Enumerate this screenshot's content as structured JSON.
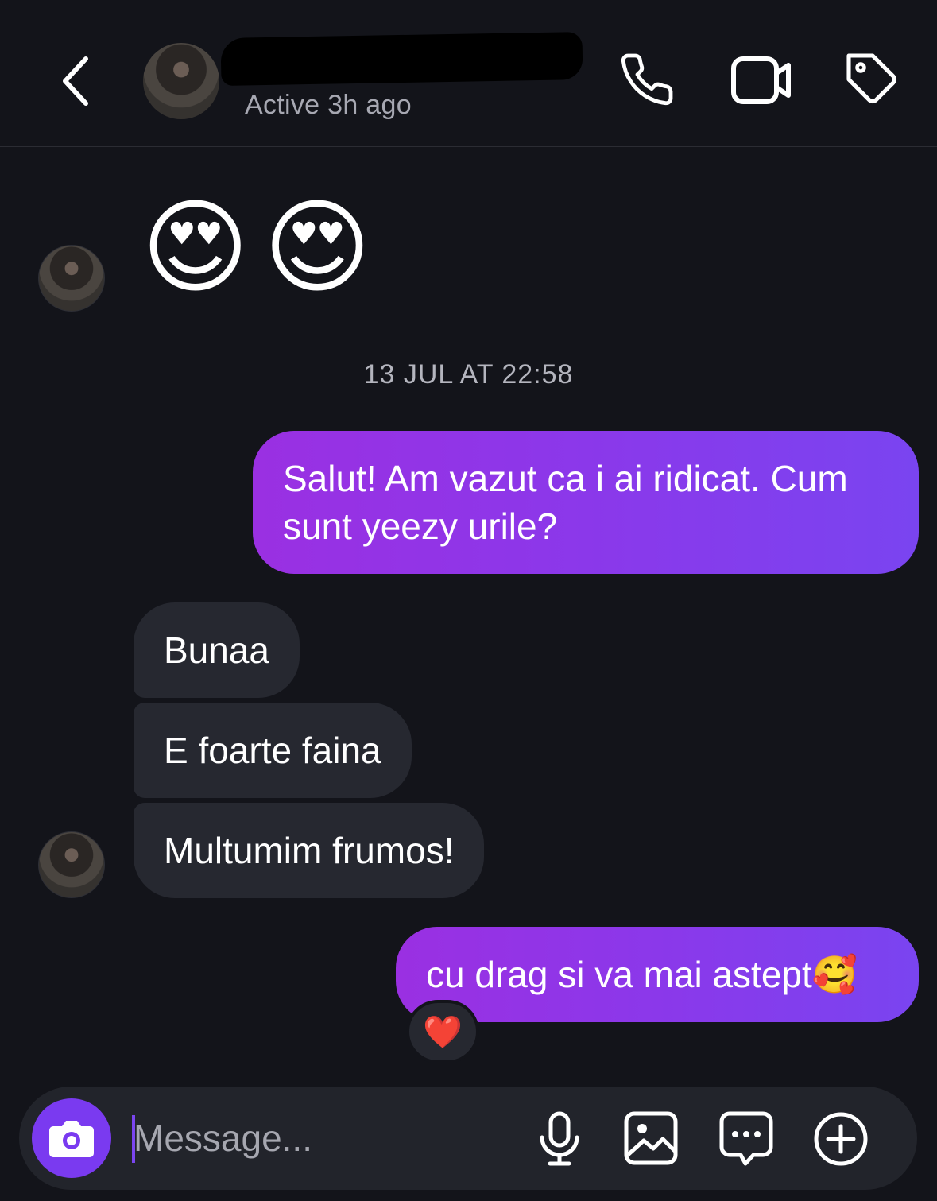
{
  "header": {
    "status": "Active 3h ago",
    "icons": {
      "back": "chevron-left-icon",
      "call": "phone-icon",
      "video": "video-camera-icon",
      "tag": "tag-icon"
    }
  },
  "messages": {
    "emoji_message": "😍😍",
    "timestamp": "13 JUL AT 22:58",
    "outgoing_1": "Salut! Am vazut ca i ai ridicat. Cum sunt yeezy urile?",
    "incoming_1": "Bunaa",
    "incoming_2": "E foarte faina",
    "incoming_3": "Multumim frumos!",
    "outgoing_2": "cu drag si va mai astept🥰",
    "reaction": "❤️"
  },
  "composer": {
    "placeholder": "Message...",
    "value": "",
    "icons": [
      "camera-icon",
      "microphone-icon",
      "gallery-icon",
      "sticker-icon",
      "plus-icon"
    ]
  },
  "colors": {
    "background": "#13141a",
    "outgoing_bubble": "#8b38ea",
    "incoming_bubble": "#262830",
    "accent": "#7a3af0"
  }
}
